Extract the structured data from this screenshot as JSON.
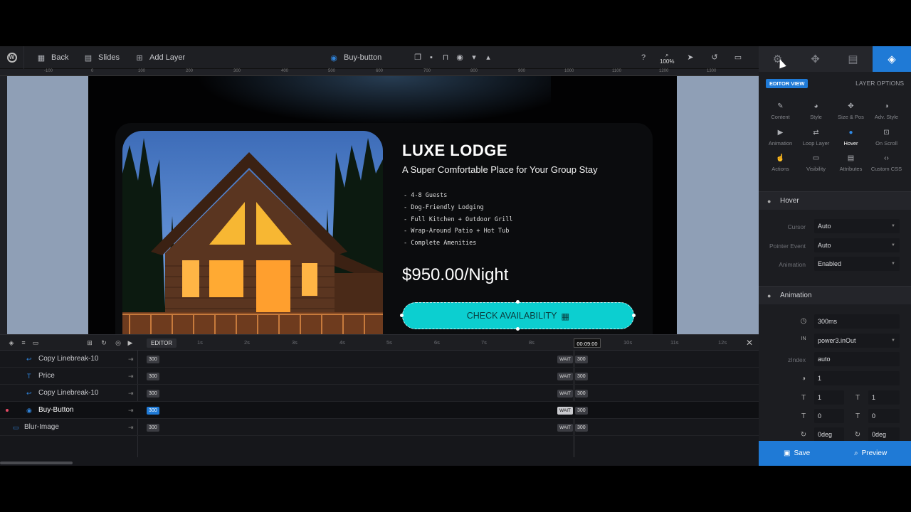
{
  "toolbar": {
    "back": "Back",
    "slides": "Slides",
    "add_layer": "Add Layer",
    "layer_name": "Buy-button",
    "zoom": "100%"
  },
  "ruler": [
    "-100",
    "0",
    "100",
    "200",
    "300",
    "400",
    "500",
    "600",
    "700",
    "800",
    "900",
    "1000",
    "1100",
    "1200",
    "1300"
  ],
  "slide": {
    "title": "LUXE LODGE",
    "subtitle": "A Super Comfortable Place for Your Group Stay",
    "features": [
      "- 4-8 Guests",
      "- Dog-Friendly Lodging",
      "- Full Kitchen + Outdoor Grill",
      "- Wrap-Around Patio + Hot Tub",
      "- Complete Amenities"
    ],
    "price": "$950.00/Night",
    "cta": "CHECK AVAILABILITY",
    "cta_icon": "calendar-icon"
  },
  "timeline": {
    "editor_label": "EDITOR",
    "ticks": [
      "1s",
      "2s",
      "3s",
      "4s",
      "5s",
      "6s",
      "7s",
      "8s",
      "10s",
      "11s",
      "12s"
    ],
    "current_time": "00:09:00",
    "layers": [
      {
        "name": "Copy Linebreak-10",
        "icon": "linebreak-icon",
        "duration": "300",
        "wait": "WAIT",
        "wait_value": "300"
      },
      {
        "name": "Price",
        "icon": "text-icon",
        "duration": "300",
        "wait": "WAIT",
        "wait_value": "300"
      },
      {
        "name": "Copy Linebreak-10",
        "icon": "linebreak-icon",
        "duration": "300",
        "wait": "WAIT",
        "wait_value": "300"
      },
      {
        "name": "Buy-Button",
        "icon": "button-icon",
        "duration": "300",
        "wait": "WAIT",
        "wait_value": "300",
        "active": true
      },
      {
        "name": "Blur-Image",
        "icon": "image-icon",
        "duration": "300",
        "wait": "WAIT",
        "wait_value": "300"
      }
    ]
  },
  "panel": {
    "editor_view": "EDITOR VIEW",
    "layer_options": "LAYER OPTIONS",
    "tabs": [
      {
        "label": "Content",
        "icon": "pencil-icon"
      },
      {
        "label": "Style",
        "icon": "palette-icon"
      },
      {
        "label": "Size & Pos",
        "icon": "move-icon"
      },
      {
        "label": "Adv. Style",
        "icon": "contrast-icon"
      },
      {
        "label": "Animation",
        "icon": "play-icon"
      },
      {
        "label": "Loop Layer",
        "icon": "loop-icon"
      },
      {
        "label": "Hover",
        "icon": "mouse-icon",
        "active": true
      },
      {
        "label": "On Scroll",
        "icon": "scroll-icon"
      },
      {
        "label": "Actions",
        "icon": "hand-icon"
      },
      {
        "label": "Visibility",
        "icon": "visibility-icon"
      },
      {
        "label": "Attributes",
        "icon": "document-icon"
      },
      {
        "label": "Custom CSS",
        "icon": "code-icon"
      }
    ],
    "hover": {
      "section": "Hover",
      "cursor_label": "Cursor",
      "cursor_value": "Auto",
      "pointer_label": "Pointer Event",
      "pointer_value": "Auto",
      "animation_label": "Animation",
      "animation_value": "Enabled"
    },
    "animation": {
      "section": "Animation",
      "duration": "300ms",
      "easing": "power3.inOut",
      "zindex_label": "zIndex",
      "zindex_value": "auto",
      "opacity": "1",
      "scale_x": "1",
      "scale_y": "1",
      "skew_x": "0",
      "skew_y": "0",
      "rotate_x": "0deg",
      "rotate_y": "0deg"
    },
    "save": "Save",
    "preview": "Preview"
  }
}
